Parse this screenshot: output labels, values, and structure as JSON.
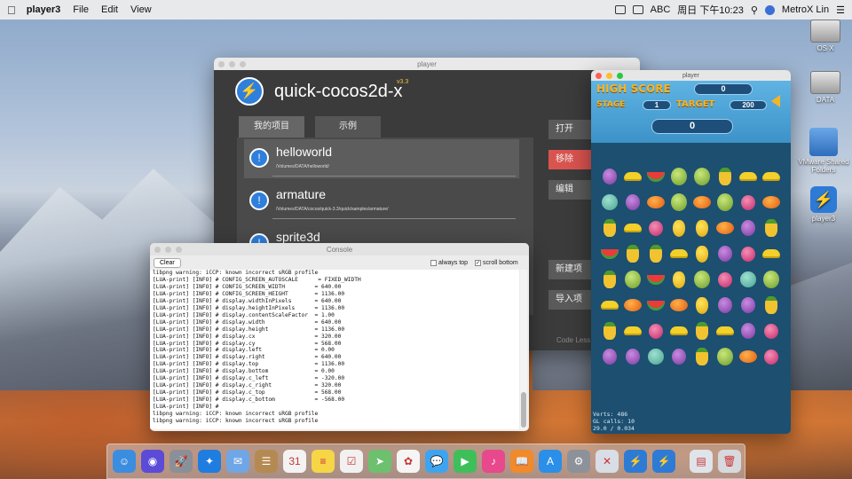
{
  "menubar": {
    "app_name": "player3",
    "menu_items": [
      "File",
      "Edit",
      "View"
    ],
    "input_label": "ABC",
    "clock": "周日 下午10:23",
    "user": "MetroX Lin"
  },
  "desktop_icons": [
    "OS X",
    "DATA",
    "VMware Shared Folders",
    "player3"
  ],
  "player_window": {
    "title": "player",
    "app_title": "quick-cocos2d-x",
    "version": "v3.3",
    "tabs": [
      "我的项目",
      "示例"
    ],
    "projects": [
      {
        "name": "helloworld",
        "path": "/Volumes/DATA/helloworld/"
      },
      {
        "name": "armature",
        "path": "/Volumes/DATA/cocos/quick-3.3/quick/samples/armature/"
      },
      {
        "name": "sprite3d",
        "path": ""
      }
    ],
    "side_buttons": [
      "打开",
      "移除",
      "编辑",
      "新建项",
      "导入项"
    ],
    "footer": "Code Less"
  },
  "console": {
    "title": "Console",
    "clear_label": "Clear",
    "always_top_label": "always top",
    "always_top_checked": false,
    "scroll_bottom_label": "scroll bottom",
    "scroll_bottom_checked": true,
    "lines": [
      "libpng warning: iCCP: known incorrect sRGB profile",
      "[LUA-print] [INFO] # CONFIG_SCREEN_AUTOSCALE      = FIXED_WIDTH",
      "[LUA-print] [INFO] # CONFIG_SCREEN_WIDTH         = 640.00",
      "[LUA-print] [INFO] # CONFIG_SCREEN_HEIGHT        = 1136.00",
      "[LUA-print] [INFO] # display.widthInPixels       = 640.00",
      "[LUA-print] [INFO] # display.heightInPixels      = 1136.00",
      "[LUA-print] [INFO] # display.contentScaleFactor  = 1.00",
      "[LUA-print] [INFO] # display.width               = 640.00",
      "[LUA-print] [INFO] # display.height              = 1136.00",
      "[LUA-print] [INFO] # display.cx                  = 320.00",
      "[LUA-print] [INFO] # display.cy                  = 568.00",
      "[LUA-print] [INFO] # display.left                = 0.00",
      "[LUA-print] [INFO] # display.right               = 640.00",
      "[LUA-print] [INFO] # display.top                 = 1136.00",
      "[LUA-print] [INFO] # display.bottom              = 0.00",
      "[LUA-print] [INFO] # display.c_left              = -320.00",
      "[LUA-print] [INFO] # display.c_right             = 320.00",
      "[LUA-print] [INFO] # display.c_top               = 568.00",
      "[LUA-print] [INFO] # display.c_bottom            = -568.00",
      "[LUA-print] [INFO] #",
      "libpng warning: iCCP: known incorrect sRGB profile",
      "libpng warning: iCCP: known incorrect sRGB profile"
    ]
  },
  "game": {
    "title": "player",
    "high_score_label": "HIGH SCORE",
    "high_score": "0",
    "stage_label": "STAGE",
    "stage": "1",
    "target_label": "TARGET",
    "target": "200",
    "score": "0",
    "board": [
      [
        "grape",
        "banana",
        "melon",
        "durian",
        "durian",
        "pine",
        "banana",
        "banana"
      ],
      [
        "apple",
        "grape",
        "mango",
        "durian",
        "mango",
        "durian",
        "lychee",
        "mango"
      ],
      [
        "pine",
        "banana",
        "lychee",
        "pear",
        "pear",
        "mango",
        "grape",
        "pine"
      ],
      [
        "melon",
        "pine",
        "pine",
        "banana",
        "pear",
        "grape",
        "lychee",
        "banana"
      ],
      [
        "pine",
        "durian",
        "melon",
        "pear",
        "durian",
        "lychee",
        "apple",
        "durian"
      ],
      [
        "banana",
        "mango",
        "melon",
        "mango",
        "pear",
        "grape",
        "grape",
        "pine"
      ],
      [
        "pine",
        "banana",
        "lychee",
        "banana",
        "pine",
        "banana",
        "grape",
        "lychee"
      ],
      [
        "grape",
        "grape",
        "apple",
        "grape",
        "pine",
        "durian",
        "mango",
        "lychee"
      ]
    ],
    "stats_verts_label": "Verts:",
    "stats_verts": "486",
    "stats_calls_label": "GL calls:",
    "stats_calls": "10",
    "stats_fps": "29.0 / 0.034"
  },
  "dock": {
    "apps": [
      {
        "name": "finder-icon",
        "color": "#3b8de0",
        "glyph": "☺"
      },
      {
        "name": "siri-icon",
        "color": "#5b4bd6",
        "glyph": "◉"
      },
      {
        "name": "launchpad-icon",
        "color": "#8a8f98",
        "glyph": "🚀"
      },
      {
        "name": "safari-icon",
        "color": "#1f7de0",
        "glyph": "✦"
      },
      {
        "name": "mail-icon",
        "color": "#6fa6e6",
        "glyph": "✉"
      },
      {
        "name": "contacts-icon",
        "color": "#b58a52",
        "glyph": "☰"
      },
      {
        "name": "calendar-icon",
        "color": "#f3f3f3",
        "glyph": "31"
      },
      {
        "name": "notes-icon",
        "color": "#f6d547",
        "glyph": "≡"
      },
      {
        "name": "reminders-icon",
        "color": "#f1f1f1",
        "glyph": "☑"
      },
      {
        "name": "maps-icon",
        "color": "#6cc06e",
        "glyph": "➤"
      },
      {
        "name": "photos-icon",
        "color": "#f5f5f5",
        "glyph": "✿"
      },
      {
        "name": "messages-icon",
        "color": "#3fa4f0",
        "glyph": "💬"
      },
      {
        "name": "facetime-icon",
        "color": "#3fbf5a",
        "glyph": "▶"
      },
      {
        "name": "itunes-icon",
        "color": "#e8488c",
        "glyph": "♪"
      },
      {
        "name": "ibooks-icon",
        "color": "#f08a2a",
        "glyph": "📖"
      },
      {
        "name": "appstore-icon",
        "color": "#2a8fe8",
        "glyph": "A"
      },
      {
        "name": "system-preferences-icon",
        "color": "#8d9199",
        "glyph": "⚙"
      },
      {
        "name": "xcode-icon",
        "color": "#d8dde6",
        "glyph": "✕"
      },
      {
        "name": "player-icon",
        "color": "#2e7bd6",
        "glyph": "⚡"
      },
      {
        "name": "player3-icon",
        "color": "#2e7bd6",
        "glyph": "⚡"
      }
    ],
    "stack_apps": [
      {
        "name": "downloads-stack-icon",
        "color": "#dfe4ea",
        "glyph": "▤"
      },
      {
        "name": "trash-icon",
        "color": "#d6d9de",
        "glyph": "🗑"
      }
    ]
  },
  "colors": {
    "player_bg": "#3b3b3b",
    "accent_blue": "#2f7fdc",
    "remove_red": "#d9534f",
    "game_gold": "#f1b52a"
  }
}
